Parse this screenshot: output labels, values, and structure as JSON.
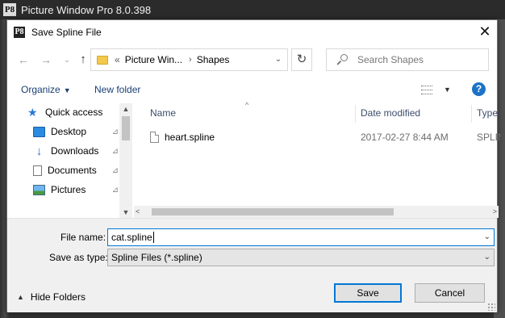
{
  "app": {
    "title": "Picture Window Pro 8.0.398",
    "logo_text": "P8"
  },
  "dialog": {
    "title": "Save Spline File",
    "logo_text": "P8",
    "close_glyph": "✕"
  },
  "nav": {
    "back_glyph": "←",
    "forward_glyph": "→",
    "recent_glyph": "⌄",
    "up_glyph": "↑",
    "address": {
      "overflow": "«",
      "segments": [
        "Picture Win...",
        "Shapes"
      ],
      "sep": "›",
      "drop": "⌄"
    },
    "refresh_glyph": "↻",
    "search_placeholder": "Search Shapes"
  },
  "toolbar": {
    "organize": "Organize",
    "organize_caret": "▼",
    "new_folder": "New folder",
    "view_caret": "▼",
    "help": "?"
  },
  "sidebar": {
    "items": [
      {
        "label": "Quick access",
        "icon": "star-icon",
        "pinned": false
      },
      {
        "label": "Desktop",
        "icon": "desktop-icon",
        "pinned": true
      },
      {
        "label": "Downloads",
        "icon": "download-icon",
        "pinned": true
      },
      {
        "label": "Documents",
        "icon": "documents-icon",
        "pinned": true
      },
      {
        "label": "Pictures",
        "icon": "pictures-icon",
        "pinned": true
      }
    ],
    "pin_glyph": "📌",
    "scroll_up": "▲",
    "scroll_down": "▼"
  },
  "files": {
    "sort_glyph": "^",
    "columns": {
      "name": "Name",
      "date": "Date modified",
      "type": "Type"
    },
    "rows": [
      {
        "name": "heart.spline",
        "date": "2017-02-27 8:44 AM",
        "type": "SPLINE"
      }
    ],
    "scroll_left": "<",
    "scroll_right": ">"
  },
  "form": {
    "filename_label": "File name:",
    "filename_value": "cat.spline",
    "savetype_label": "Save as type:",
    "savetype_value": "Spline Files (*.spline)",
    "drop": "⌄",
    "hide_folders": "Hide Folders",
    "hide_chev": "▲",
    "save": "Save",
    "cancel": "Cancel"
  }
}
